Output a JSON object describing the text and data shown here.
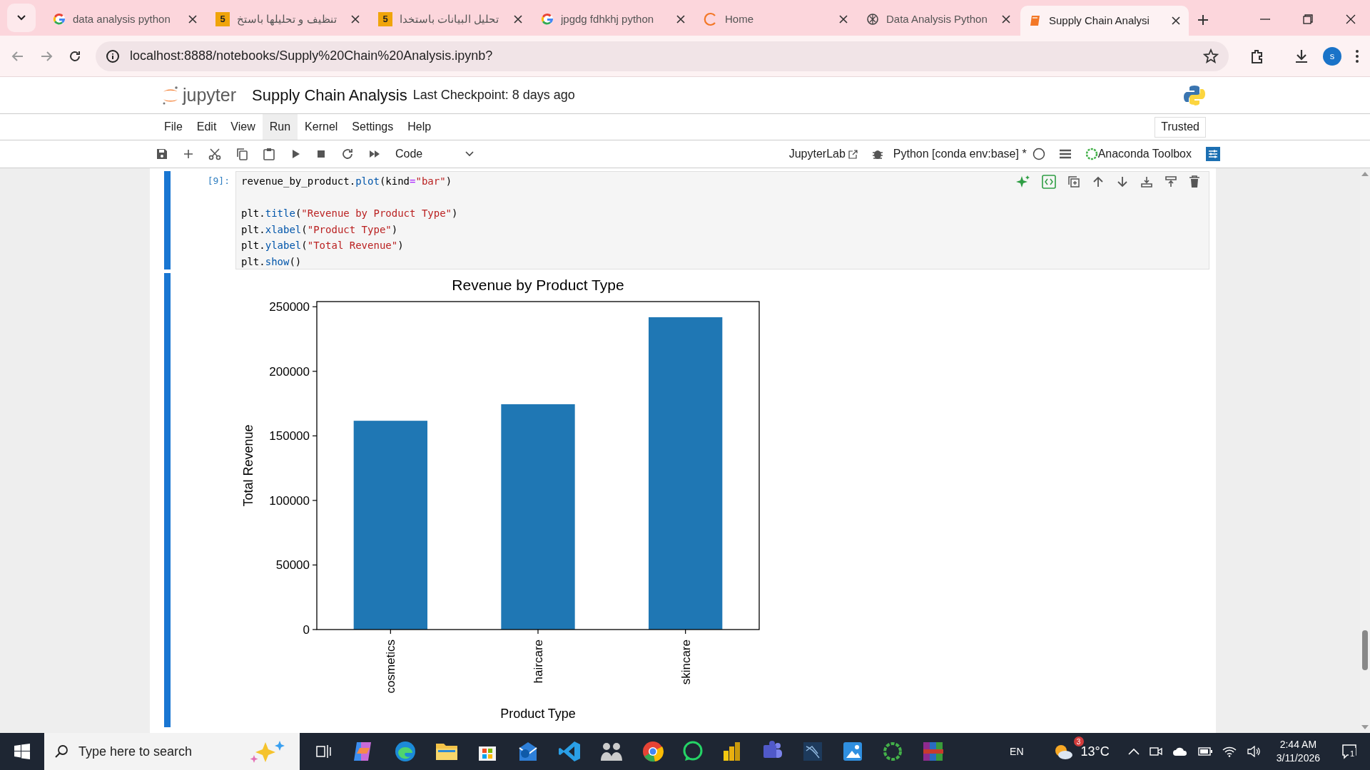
{
  "browser": {
    "tabs": [
      {
        "title": "data analysis python",
        "kind": "google",
        "selected": false
      },
      {
        "title": "تنظيف و تحليلها باستخ",
        "kind": "five",
        "icon_text": "5",
        "selected": false
      },
      {
        "title": "تحليل البيانات باستخدا",
        "kind": "five",
        "icon_text": "5",
        "selected": false
      },
      {
        "title": "jpgdg fdhkhj python",
        "kind": "google",
        "selected": false
      },
      {
        "title": "Home",
        "kind": "jupyter",
        "selected": false
      },
      {
        "title": "Data Analysis Python",
        "kind": "openai",
        "selected": false
      },
      {
        "title": "Supply Chain Analysi",
        "kind": "notebook",
        "selected": true
      }
    ],
    "address": "localhost:8888/notebooks/Supply%20Chain%20Analysis.ipynb?",
    "profile_initial": "s"
  },
  "notebook": {
    "logo_text": "jupyter",
    "title": "Supply Chain Analysis",
    "checkpoint": "Last Checkpoint: 8 days ago",
    "menu": [
      {
        "label": "File",
        "selected": false
      },
      {
        "label": "Edit",
        "selected": false
      },
      {
        "label": "View",
        "selected": false
      },
      {
        "label": "Run",
        "selected": true
      },
      {
        "label": "Kernel",
        "selected": false
      },
      {
        "label": "Settings",
        "selected": false
      },
      {
        "label": "Help",
        "selected": false
      }
    ],
    "trusted": "Trusted",
    "cell_type": "Code",
    "jupyterlab_link": "JupyterLab",
    "kernel": "Python [conda env:base] *",
    "anaconda": "Anaconda Toolbox"
  },
  "cell": {
    "prompt": "[9]:",
    "lines": [
      {
        "kind": "code",
        "tokens": [
          {
            "kind": "plain",
            "text": "revenue_by_product."
          },
          {
            "kind": "func",
            "text": "plot"
          },
          {
            "kind": "plain",
            "text": "(kind"
          },
          {
            "kind": "op",
            "text": "="
          },
          {
            "kind": "string",
            "text": "\"bar\""
          },
          {
            "kind": "plain",
            "text": ")"
          }
        ]
      },
      {
        "kind": "blank"
      },
      {
        "kind": "code",
        "tokens": [
          {
            "kind": "plain",
            "text": "plt."
          },
          {
            "kind": "func",
            "text": "title"
          },
          {
            "kind": "plain",
            "text": "("
          },
          {
            "kind": "string",
            "text": "\"Revenue by Product Type\""
          },
          {
            "kind": "plain",
            "text": ")"
          }
        ]
      },
      {
        "kind": "code",
        "tokens": [
          {
            "kind": "plain",
            "text": "plt."
          },
          {
            "kind": "func",
            "text": "xlabel"
          },
          {
            "kind": "plain",
            "text": "("
          },
          {
            "kind": "string",
            "text": "\"Product Type\""
          },
          {
            "kind": "plain",
            "text": ")"
          }
        ]
      },
      {
        "kind": "code",
        "tokens": [
          {
            "kind": "plain",
            "text": "plt."
          },
          {
            "kind": "func",
            "text": "ylabel"
          },
          {
            "kind": "plain",
            "text": "("
          },
          {
            "kind": "string",
            "text": "\"Total Revenue\""
          },
          {
            "kind": "plain",
            "text": ")"
          }
        ]
      },
      {
        "kind": "code",
        "tokens": [
          {
            "kind": "plain",
            "text": "plt."
          },
          {
            "kind": "func",
            "text": "show"
          },
          {
            "kind": "plain",
            "text": "()"
          }
        ]
      }
    ],
    "chart_data": {
      "type": "bar",
      "title": "Revenue by Product Type",
      "xlabel": "Product Type",
      "ylabel": "Total Revenue",
      "categories": [
        "cosmetics",
        "haircare",
        "skincare"
      ],
      "series": [
        {
          "color": "#1f77b4",
          "values": [
            161700,
            174500,
            241900
          ]
        }
      ],
      "ylim": [
        0,
        254000
      ],
      "yticks": [
        0,
        50000,
        100000,
        150000,
        200000,
        250000
      ]
    }
  },
  "taskbar": {
    "search_placeholder": "Type here to search",
    "language": "EN",
    "weather_badge": "3",
    "temperature": "13°C",
    "time": "2:44 AM",
    "date": "3/11/2026",
    "notifications": "1"
  }
}
